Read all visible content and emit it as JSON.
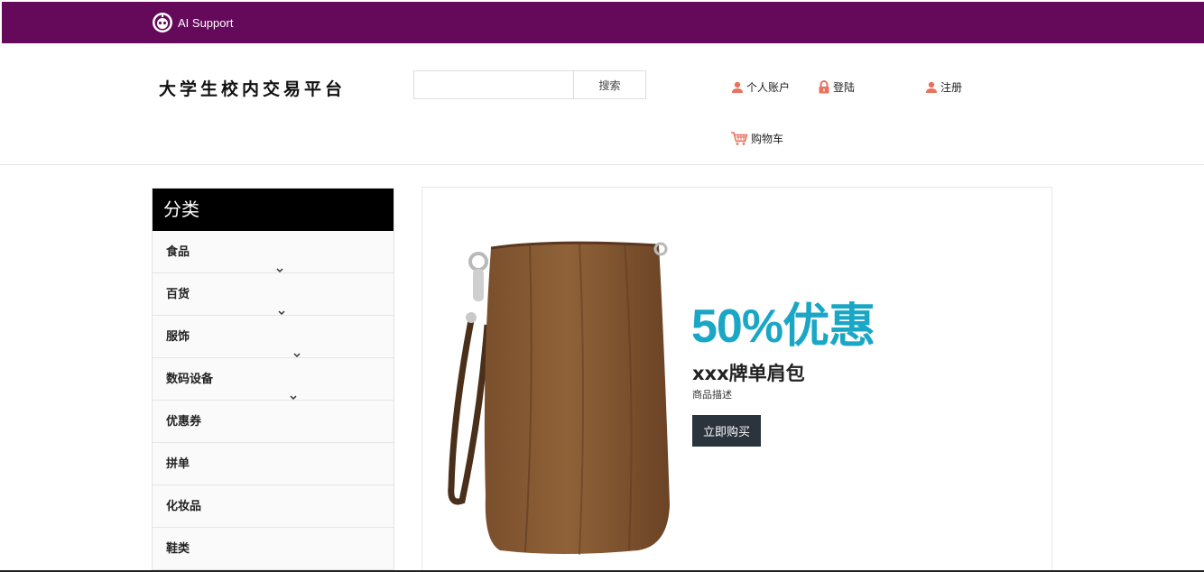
{
  "topbar": {
    "brand": "AI Support",
    "color": "#650a5b"
  },
  "header": {
    "site_title": "大学生校内交易平台",
    "search": {
      "placeholder": "",
      "button": "搜索"
    },
    "links": {
      "account": "个人账户",
      "login": "登陆",
      "register": "注册",
      "cart": "购物车"
    },
    "icon_color": "#e8725f"
  },
  "sidebar": {
    "title": "分类",
    "items": [
      {
        "label": "食品",
        "chevron": "⌄"
      },
      {
        "label": "百货",
        "chevron": "⌄"
      },
      {
        "label": "服饰",
        "chevron": "⌄"
      },
      {
        "label": "数码设备",
        "chevron": "⌄"
      },
      {
        "label": "优惠券"
      },
      {
        "label": "拼单"
      },
      {
        "label": "化妆品"
      },
      {
        "label": "鞋类"
      }
    ]
  },
  "banner": {
    "discount": "50%优惠",
    "product_name": "xxx牌单肩包",
    "description": "商品描述",
    "buy_button": "立即购买",
    "accent": "#1aa7c6"
  }
}
